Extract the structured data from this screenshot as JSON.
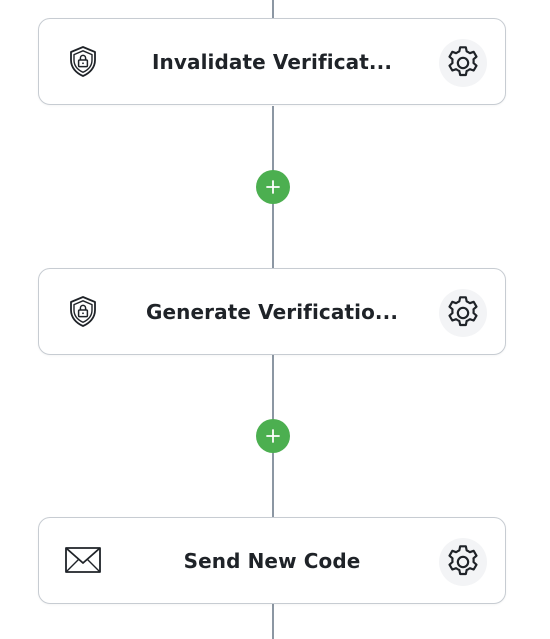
{
  "flow": {
    "nodes": [
      {
        "label": "Invalidate Verificat...",
        "icon": "shield-lock-icon"
      },
      {
        "label": "Generate Verificatio...",
        "icon": "shield-lock-icon"
      },
      {
        "label": "Send New Code",
        "icon": "envelope-icon"
      }
    ],
    "colors": {
      "connector": "#8c97a3",
      "add_button": "#4caf50",
      "node_border": "#c7ccd2",
      "text": "#1f2328"
    }
  }
}
